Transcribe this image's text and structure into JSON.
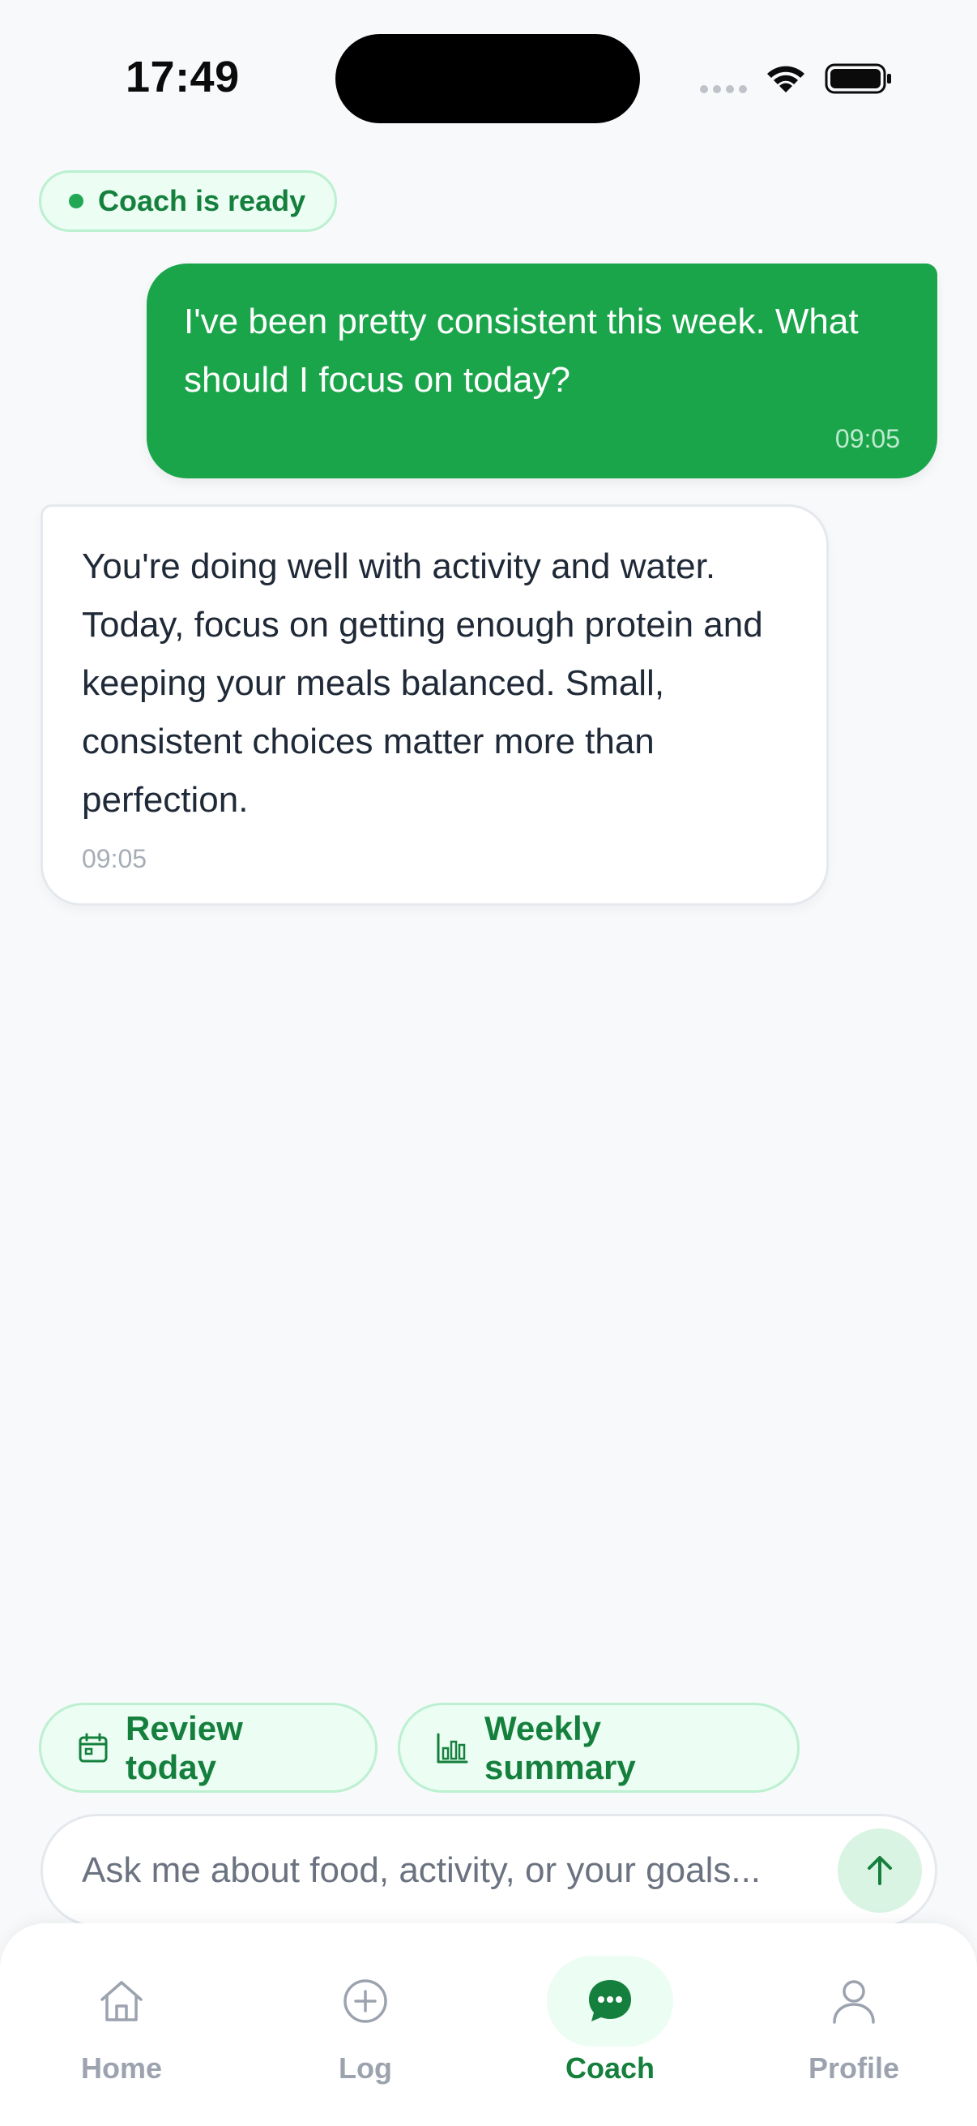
{
  "status_bar": {
    "time": "17:49"
  },
  "status": {
    "label": "Coach is ready"
  },
  "messages": [
    {
      "role": "user",
      "text": "I've been pretty consistent this week. What should I focus on today?",
      "time": "09:05"
    },
    {
      "role": "coach",
      "text": "You're doing well with activity and water. Today, focus on getting enough protein and keeping your meals balanced. Small, consistent choices matter more than perfection.",
      "time": "09:05"
    }
  ],
  "quick_actions": [
    {
      "label": "Review today",
      "icon": "calendar-icon"
    },
    {
      "label": "Weekly summary",
      "icon": "bar-chart-icon"
    }
  ],
  "composer": {
    "placeholder": "Ask me about food, activity, or your goals...",
    "value": "",
    "send_icon": "arrow-up-icon"
  },
  "nav": {
    "items": [
      {
        "label": "Home",
        "icon": "home-icon",
        "active": false
      },
      {
        "label": "Log",
        "icon": "plus-circle-icon",
        "active": false
      },
      {
        "label": "Coach",
        "icon": "chat-bubble-icon",
        "active": true
      },
      {
        "label": "Profile",
        "icon": "user-icon",
        "active": false
      }
    ]
  },
  "colors": {
    "accent": "#1ba54a",
    "accent_dark": "#15803d",
    "accent_soft": "#ecfdf3",
    "inactive": "#9ca3af",
    "background": "#f7f9fb"
  }
}
